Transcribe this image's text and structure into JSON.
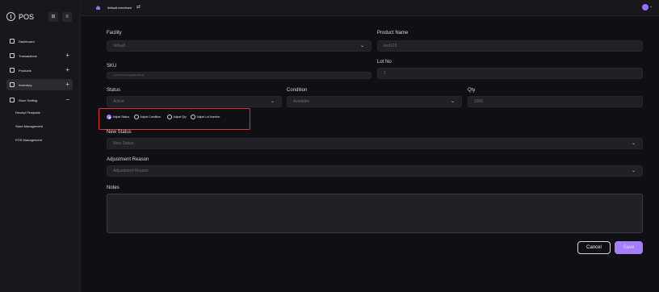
{
  "brand": {
    "name": "POS",
    "btn_a": "⊞",
    "btn_b": "≡"
  },
  "sidebar": {
    "items": [
      {
        "label": "Dashboard"
      },
      {
        "label": "Transactions"
      },
      {
        "label": "Products"
      },
      {
        "label": "Inventory"
      },
      {
        "label": "Store Setting"
      }
    ],
    "subitems": [
      {
        "label": "Receipt Template"
      },
      {
        "label": "Store Management"
      },
      {
        "label": "POS Management"
      }
    ]
  },
  "topbar": {
    "merchant": "default merchant"
  },
  "form": {
    "facility": {
      "label": "Facility",
      "value": "default"
    },
    "product_name": {
      "label": "Product Name",
      "value": "test123"
    },
    "sku": {
      "label": "SKU",
      "value": "eef72fb5dcdb4aed8a4a6ed1"
    },
    "lot_no": {
      "label": "Lot No",
      "value": "1"
    },
    "status": {
      "label": "Status",
      "value": "Active"
    },
    "condition": {
      "label": "Condition",
      "value": "Available"
    },
    "qty": {
      "label": "Qty",
      "value": "1000"
    },
    "radios": [
      "Adjust Status",
      "Adjust Condition",
      "Adjust Qty",
      "Adjust Lot Number"
    ],
    "new_status": {
      "label": "New Status",
      "placeholder": "New Status"
    },
    "adjustment_reason": {
      "label": "Adjustment Reason",
      "placeholder": "Adjustment Reason"
    },
    "notes": {
      "label": "Notes"
    },
    "cancel": "Cancel",
    "save": "Save"
  },
  "colors": {
    "accent": "#a57dff",
    "highlight": "#e0352b"
  }
}
